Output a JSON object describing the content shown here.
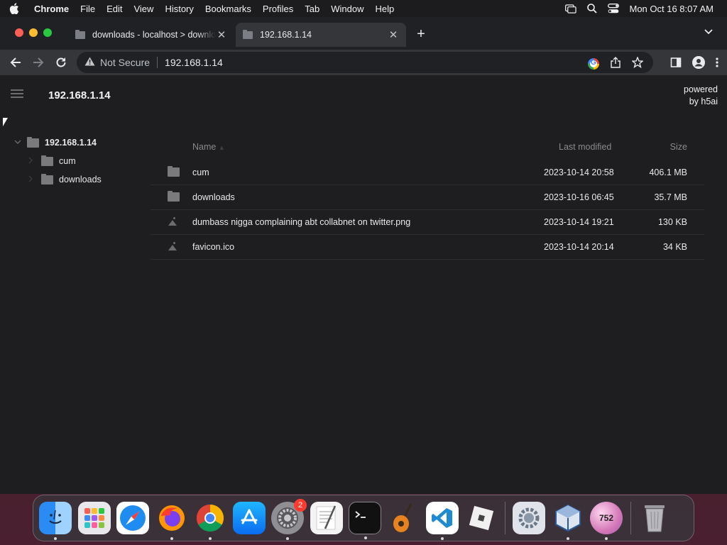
{
  "menubar": {
    "app_name": "Chrome",
    "items": [
      "File",
      "Edit",
      "View",
      "History",
      "Bookmarks",
      "Profiles",
      "Tab",
      "Window",
      "Help"
    ],
    "clock": "Mon Oct 16  8:07 AM"
  },
  "tabs": [
    {
      "title": "downloads - localhost > downloads",
      "active": false
    },
    {
      "title": "192.168.1.14",
      "active": true
    }
  ],
  "omnibox": {
    "security_label": "Not Secure",
    "url": "192.168.1.14"
  },
  "page": {
    "title": "192.168.1.14",
    "powered_line1": "powered",
    "powered_line2": "by h5ai"
  },
  "tree": {
    "root": "192.168.1.14",
    "children": [
      "cum",
      "downloads"
    ]
  },
  "listing": {
    "headers": {
      "name": "Name",
      "modified": "Last modified",
      "size": "Size"
    },
    "rows": [
      {
        "type": "folder",
        "name": "cum",
        "modified": "2023-10-14 20:58",
        "size": "406.1 MB"
      },
      {
        "type": "folder",
        "name": "downloads",
        "modified": "2023-10-16 06:45",
        "size": "35.7 MB"
      },
      {
        "type": "image",
        "name": "dumbass nigga complaining abt collabnet on twitter.png",
        "modified": "2023-10-14 19:21",
        "size": "130 KB"
      },
      {
        "type": "image",
        "name": "favicon.ico",
        "modified": "2023-10-14 20:14",
        "size": "34 KB"
      }
    ]
  },
  "dock": {
    "system_settings_badge": "2",
    "counter_label": "752"
  }
}
